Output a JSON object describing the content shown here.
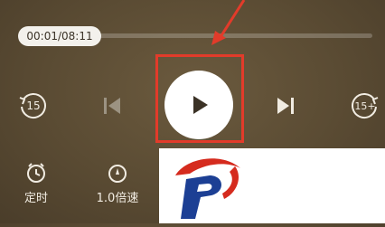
{
  "player": {
    "time_display": "00:01/08:11"
  },
  "controls": {
    "rewind_label": "15",
    "forward_label": "15+"
  },
  "bottom": {
    "timer_label": "定时",
    "speed_label": "1.0倍速"
  },
  "colors": {
    "accent_red": "#e23b2a",
    "logo_red": "#d52b1e",
    "logo_blue": "#1c3f94"
  }
}
